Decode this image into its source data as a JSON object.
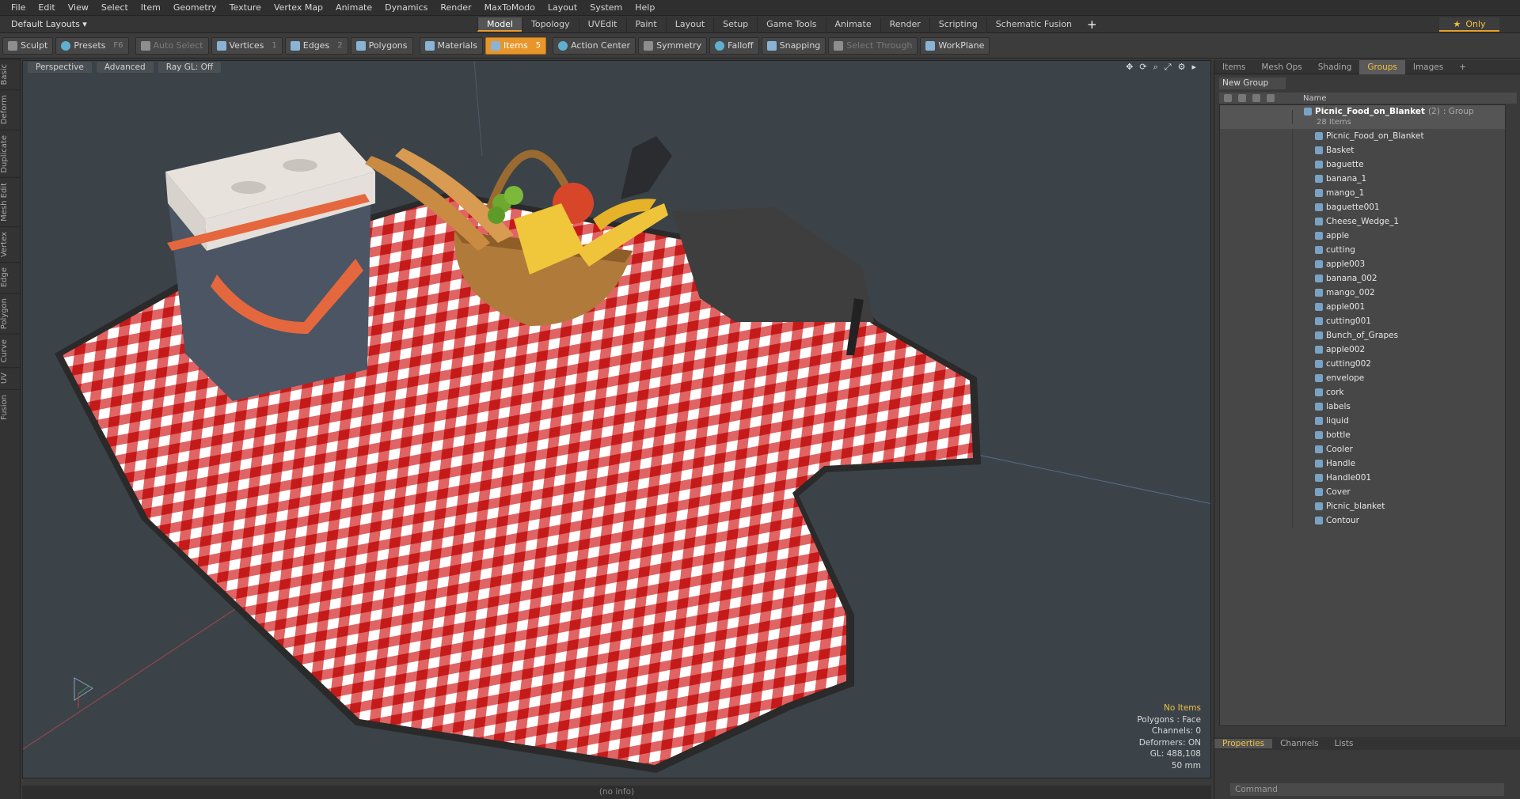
{
  "menu": [
    "File",
    "Edit",
    "View",
    "Select",
    "Item",
    "Geometry",
    "Texture",
    "Vertex Map",
    "Animate",
    "Dynamics",
    "Render",
    "MaxToModo",
    "Layout",
    "System",
    "Help"
  ],
  "layout_selector": "Default Layouts ▾",
  "layout_tabs": [
    "Model",
    "Topology",
    "UVEdit",
    "Paint",
    "Layout",
    "Setup",
    "Game Tools",
    "Animate",
    "Render",
    "Scripting",
    "Schematic Fusion"
  ],
  "active_tab": "Model",
  "only_label": "Only",
  "toolbar": {
    "sculpt": "Sculpt",
    "presets": "Presets",
    "presets_key": "F6",
    "auto_select": "Auto Select",
    "vertices": "Vertices",
    "vertices_key": "1",
    "edges": "Edges",
    "edges_key": "2",
    "polygons": "Polygons",
    "materials": "Materials",
    "items": "Items",
    "items_key": "5",
    "action_center": "Action Center",
    "symmetry": "Symmetry",
    "falloff": "Falloff",
    "snapping": "Snapping",
    "select_through": "Select Through",
    "workplane": "WorkPlane"
  },
  "left_rail": [
    "Basic",
    "Deform",
    "Duplicate",
    "Mesh Edit",
    "Vertex",
    "Edge",
    "Polygon",
    "Curve",
    "UV",
    "Fusion"
  ],
  "viewport": {
    "view_mode": "Perspective",
    "shading": "Advanced",
    "raygl": "Ray GL: Off",
    "info": {
      "items": "No Items",
      "polygons": "Polygons : Face",
      "channels": "Channels: 0",
      "deformers": "Deformers: ON",
      "gl": "GL: 488,108",
      "scale": "50 mm"
    }
  },
  "status": "(no info)",
  "right_panel": {
    "tabs": [
      "Items",
      "Mesh Ops",
      "Shading",
      "Groups",
      "Images"
    ],
    "active_tab": "Groups",
    "new_group": "New Group",
    "name_header": "Name",
    "root": {
      "name": "Picnic_Food_on_Blanket",
      "count": "(2)",
      "type": ": Group",
      "items": "28 Items"
    },
    "items": [
      "Picnic_Food_on_Blanket",
      "Basket",
      "baguette",
      "banana_1",
      "mango_1",
      "baguette001",
      "Cheese_Wedge_1",
      "apple",
      "cutting",
      "apple003",
      "banana_002",
      "mango_002",
      "apple001",
      "cutting001",
      "Bunch_of_Grapes",
      "apple002",
      "cutting002",
      "envelope",
      "cork",
      "labels",
      "liquid",
      "bottle",
      "Cooler",
      "Handle",
      "Handle001",
      "Cover",
      "Picnic_blanket",
      "Contour"
    ],
    "bottom_tabs": [
      "Properties",
      "Channels",
      "Lists"
    ],
    "command_placeholder": "Command"
  }
}
